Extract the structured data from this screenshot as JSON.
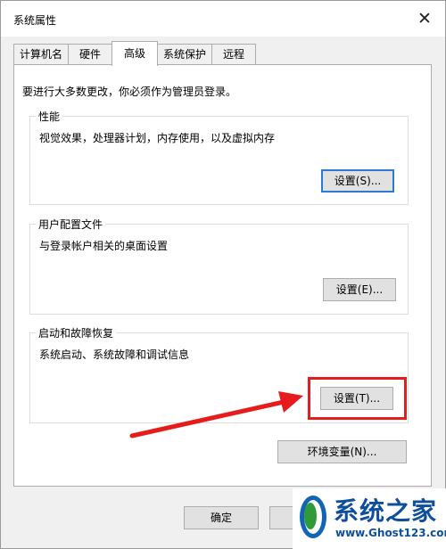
{
  "window": {
    "title": "系统属性",
    "close_glyph": "✕"
  },
  "tabs": [
    {
      "label": "计算机名"
    },
    {
      "label": "硬件"
    },
    {
      "label": "高级",
      "active": true
    },
    {
      "label": "系统保护"
    },
    {
      "label": "远程"
    }
  ],
  "admin_note": "要进行大多数更改，你必须作为管理员登录。",
  "performance": {
    "title": "性能",
    "description": "视觉效果，处理器计划，内存使用，以及虚拟内存",
    "button": "设置(S)..."
  },
  "user_profiles": {
    "title": "用户配置文件",
    "description": "与登录帐户相关的桌面设置",
    "button": "设置(E)..."
  },
  "startup_recovery": {
    "title": "启动和故障恢复",
    "description": "系统启动、系统故障和调试信息",
    "button": "设置(T)..."
  },
  "env_button": "环境变量(N)...",
  "footer": {
    "ok": "确定"
  },
  "watermark": {
    "text": "系统之家",
    "url": "www.Ghost123.com"
  },
  "annotation": {
    "color": "#e61b1b"
  }
}
